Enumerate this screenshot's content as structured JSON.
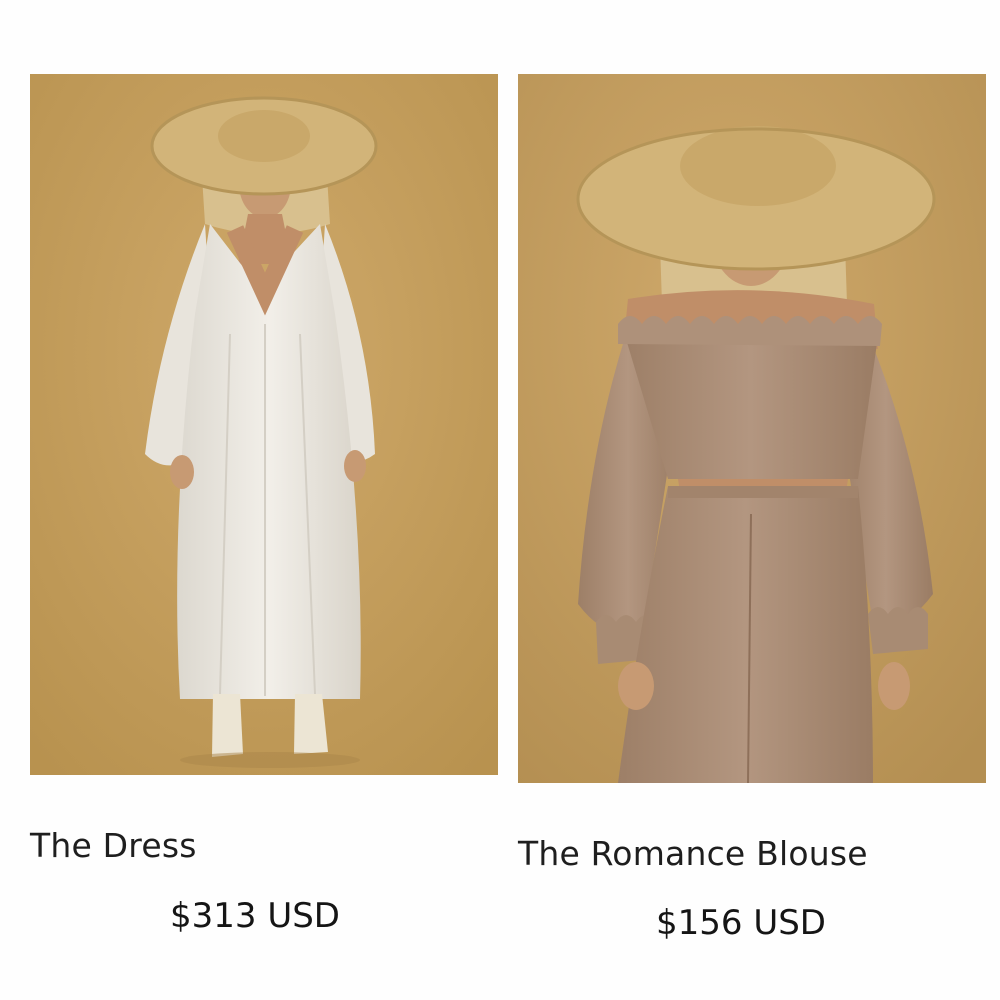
{
  "products": [
    {
      "title": "The Dress",
      "price": "$313 USD",
      "image_alt": "Model in white long-sleeve maxi dress and wide straw hat"
    },
    {
      "title": "The Romance Blouse",
      "price": "$156 USD",
      "image_alt": "Model in taupe off-shoulder ruffle blouse and matching pants with wide straw hat"
    }
  ],
  "colors": {
    "backdrop": "#c4a063",
    "hat": "#d2b479",
    "dress": "#eeebe4",
    "blouse": "#a88b73",
    "skin": "#c79a73",
    "hair": "#d8c08e"
  }
}
